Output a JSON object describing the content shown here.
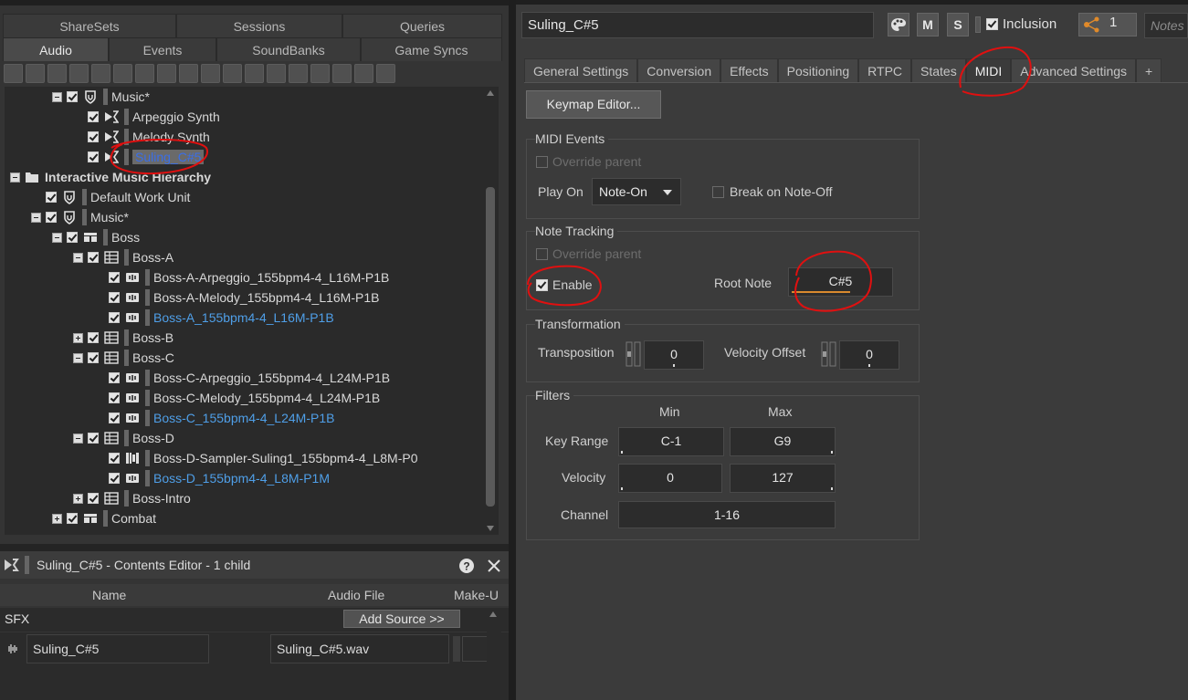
{
  "left_tabs_row1": [
    "ShareSets",
    "Sessions",
    "Queries"
  ],
  "left_tabs_row2": [
    "Audio",
    "Events",
    "SoundBanks",
    "Game Syncs"
  ],
  "tree": [
    {
      "label": "Music*",
      "indent": 2,
      "expander": "minus",
      "icon": "work-unit-icon"
    },
    {
      "label": "Arpeggio Synth",
      "indent": 3,
      "expander": "none",
      "icon": "sfx-icon"
    },
    {
      "label": "Melody Synth",
      "indent": 3,
      "expander": "none",
      "icon": "sfx-icon"
    },
    {
      "label": "Suling_C#5",
      "indent": 3,
      "expander": "none",
      "icon": "sfx-icon",
      "selected": true
    },
    {
      "label": "Interactive Music Hierarchy",
      "indent": 0,
      "expander": "minus",
      "icon": "folder-icon",
      "bold": true
    },
    {
      "label": "Default Work Unit",
      "indent": 1,
      "expander": "none",
      "icon": "work-unit-icon"
    },
    {
      "label": "Music*",
      "indent": 1,
      "expander": "minus",
      "icon": "work-unit-icon"
    },
    {
      "label": "Boss",
      "indent": 2,
      "expander": "minus",
      "icon": "switch-container-icon"
    },
    {
      "label": "Boss-A",
      "indent": 3,
      "expander": "minus",
      "icon": "playlist-icon"
    },
    {
      "label": "Boss-A-Arpeggio_155bpm4-4_L16M-P1B",
      "indent": 4,
      "expander": "none",
      "icon": "segment-icon"
    },
    {
      "label": "Boss-A-Melody_155bpm4-4_L16M-P1B",
      "indent": 4,
      "expander": "none",
      "icon": "segment-icon"
    },
    {
      "label": "Boss-A_155bpm4-4_L16M-P1B",
      "indent": 4,
      "expander": "none",
      "icon": "segment-icon",
      "blue": true
    },
    {
      "label": "Boss-B",
      "indent": 3,
      "expander": "plus",
      "icon": "playlist-icon"
    },
    {
      "label": "Boss-C",
      "indent": 3,
      "expander": "minus",
      "icon": "playlist-icon"
    },
    {
      "label": "Boss-C-Arpeggio_155bpm4-4_L24M-P1B",
      "indent": 4,
      "expander": "none",
      "icon": "segment-icon"
    },
    {
      "label": "Boss-C-Melody_155bpm4-4_L24M-P1B",
      "indent": 4,
      "expander": "none",
      "icon": "segment-icon"
    },
    {
      "label": "Boss-C_155bpm4-4_L24M-P1B",
      "indent": 4,
      "expander": "none",
      "icon": "segment-icon",
      "blue": true
    },
    {
      "label": "Boss-D",
      "indent": 3,
      "expander": "minus",
      "icon": "playlist-icon"
    },
    {
      "label": "Boss-D-Sampler-Suling1_155bpm4-4_L8M-P0",
      "indent": 4,
      "expander": "none",
      "icon": "segment-midi-icon"
    },
    {
      "label": "Boss-D_155bpm4-4_L8M-P1M",
      "indent": 4,
      "expander": "none",
      "icon": "segment-icon",
      "blue": true
    },
    {
      "label": "Boss-Intro",
      "indent": 3,
      "expander": "plus",
      "icon": "playlist-icon"
    },
    {
      "label": "Combat",
      "indent": 2,
      "expander": "plus",
      "icon": "switch-container-icon"
    }
  ],
  "contents_editor": {
    "title": "Suling_C#5 - Contents Editor - 1 child",
    "col_name": "Name",
    "col_audio": "Audio File",
    "col_makeup": "Make-U",
    "group_label": "SFX",
    "add_source": "Add Source >>",
    "row_name": "Suling_C#5",
    "row_file": "Suling_C#5.wav"
  },
  "header": {
    "object_name": "Suling_C#5",
    "mute": "M",
    "solo": "S",
    "inclusion": "Inclusion",
    "share_count": "1",
    "notes_placeholder": "Notes"
  },
  "tabs": [
    "General Settings",
    "Conversion",
    "Effects",
    "Positioning",
    "RTPC",
    "States",
    "MIDI",
    "Advanced Settings",
    "+"
  ],
  "keymap_button": "Keymap Editor...",
  "midi_events": {
    "title": "MIDI Events",
    "override": "Override parent",
    "play_on_label": "Play On",
    "play_on_value": "Note-On",
    "break_label": "Break on Note-Off"
  },
  "note_tracking": {
    "title": "Note Tracking",
    "override": "Override parent",
    "enable": "Enable",
    "root_note_label": "Root Note",
    "root_note_value": "C#5"
  },
  "transformation": {
    "title": "Transformation",
    "transposition_label": "Transposition",
    "transposition_value": "0",
    "velocity_offset_label": "Velocity Offset",
    "velocity_offset_value": "0"
  },
  "filters": {
    "title": "Filters",
    "min_header": "Min",
    "max_header": "Max",
    "key_range_label": "Key Range",
    "key_range_min": "C-1",
    "key_range_max": "G9",
    "velocity_label": "Velocity",
    "velocity_min": "0",
    "velocity_max": "127",
    "channel_label": "Channel",
    "channel_value": "1-16"
  },
  "colors": {
    "annotation": "#e01010",
    "link_blue": "#4f9fe8",
    "accent_orange": "#d98a2e"
  }
}
